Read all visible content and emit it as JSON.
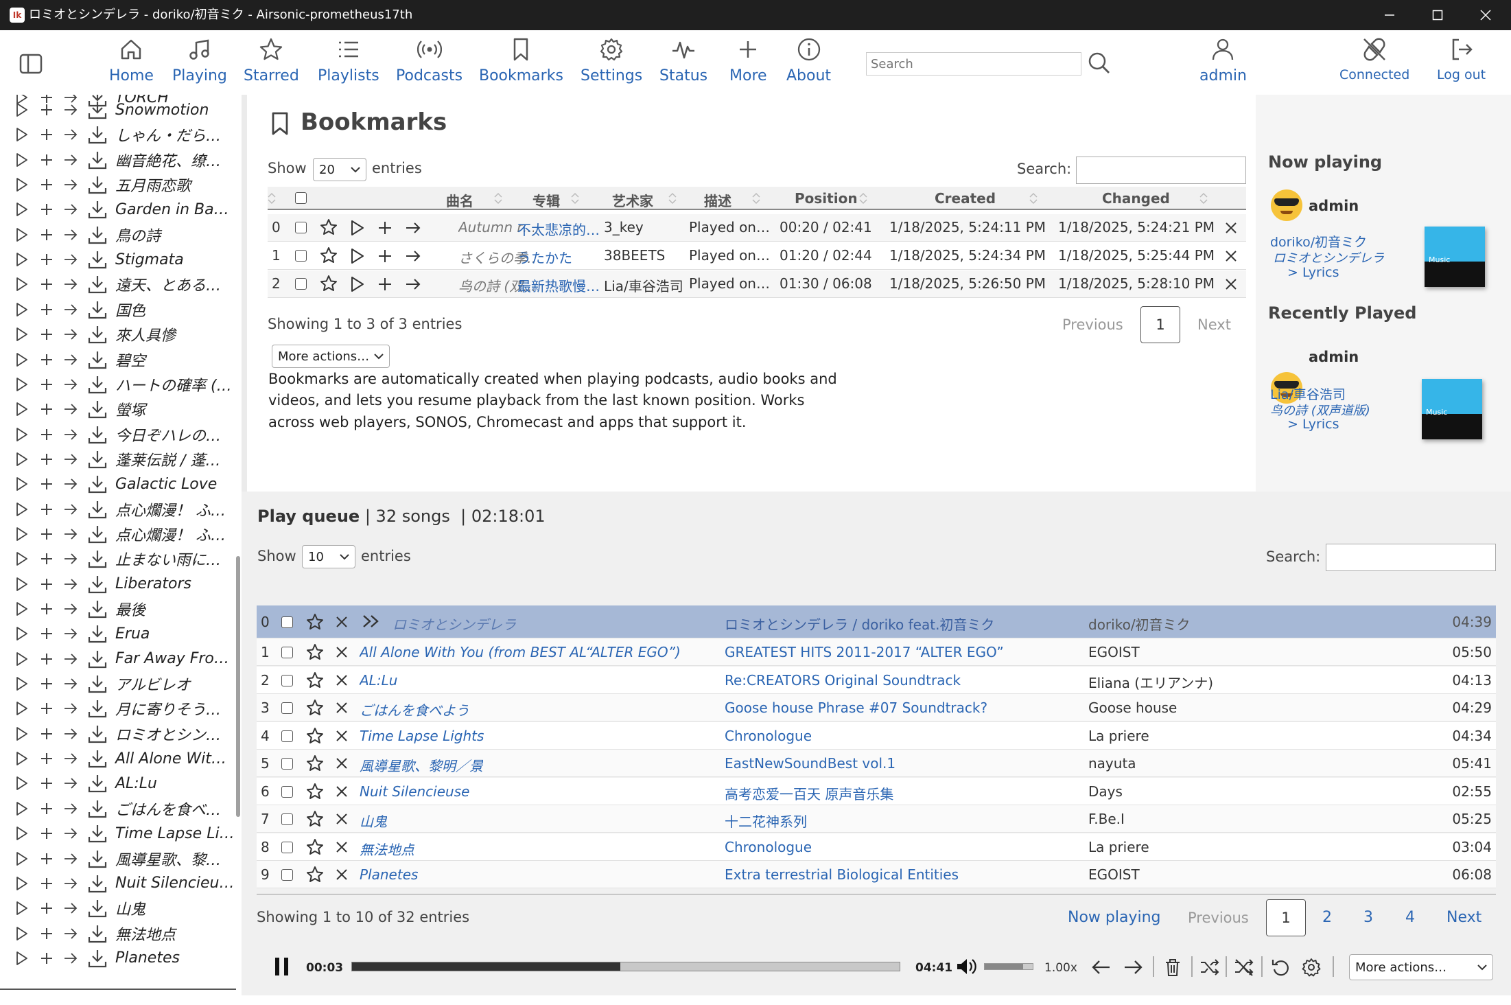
{
  "window": {
    "title": "ロミオとシンデレラ - doriko/初音ミク - Airsonic-prometheus17th",
    "app_icon": "Ik"
  },
  "nav": {
    "items": [
      {
        "label": "Home",
        "icon": "home-icon"
      },
      {
        "label": "Playing",
        "icon": "music-note-icon"
      },
      {
        "label": "Starred",
        "icon": "star-icon"
      },
      {
        "label": "Playlists",
        "icon": "list-icon"
      },
      {
        "label": "Podcasts",
        "icon": "podcast-icon"
      },
      {
        "label": "Bookmarks",
        "icon": "bookmark-icon"
      },
      {
        "label": "Settings",
        "icon": "gear-icon"
      },
      {
        "label": "Status",
        "icon": "pulse-icon"
      },
      {
        "label": "More",
        "icon": "plus-icon"
      },
      {
        "label": "About",
        "icon": "info-icon"
      }
    ],
    "search_placeholder": "Search",
    "user": "admin",
    "connected": "Connected",
    "logout": "Log out"
  },
  "sidebar": {
    "items": [
      "TORCH",
      "Snowmotion",
      "しゃん・だら…",
      "幽音絶花、缭…",
      "五月雨恋歌",
      "Garden in Ba…",
      "鳥の詩",
      "Stigmata",
      "遠天、とある…",
      "国色",
      "來人具慘",
      "碧空",
      "ハートの確率 (…",
      "螢塚",
      "今日ぞハレの…",
      "蓬莱伝説 / 蓬…",
      "Galactic Love",
      "点心爛漫！ ふ…",
      "点心爛漫！ ふ…",
      "止まない雨に…",
      "Liberators",
      "最後",
      "Erua",
      "Far Away Fro…",
      "アルビレオ",
      "月に寄りそう…",
      "ロミオとシン…",
      "All Alone Wit…",
      "AL:Lu",
      "ごはんを食べ…",
      "Time Lapse Li…",
      "風導星歌、黎…",
      "Nuit Silencieu…",
      "山鬼",
      "無法地点",
      "Planetes"
    ]
  },
  "bookmarks": {
    "title": "Bookmarks",
    "show_label": "Show",
    "page_size": "20",
    "entries_label": "entries",
    "search_label": "Search:",
    "columns": [
      "曲名",
      "专辑",
      "艺术家",
      "描述",
      "Position",
      "Created",
      "Changed"
    ],
    "rows": [
      {
        "idx": "0",
        "title": "Autumn r…",
        "album": "不太悲凉的…",
        "artist": "3_key",
        "desc": "Played on…",
        "position": "00:20 / 02:41",
        "created": "1/18/2025, 5:24:11 PM",
        "changed": "1/18/2025, 5:24:21 PM"
      },
      {
        "idx": "1",
        "title": "さくらの季…",
        "album": "うたかた",
        "artist": "38BEETS",
        "desc": "Played on…",
        "position": "01:20 / 02:44",
        "created": "1/18/2025, 5:24:34 PM",
        "changed": "1/18/2025, 5:25:44 PM"
      },
      {
        "idx": "2",
        "title": "鸟の詩 (双…",
        "album": "最新热歌慢…",
        "artist": "Lia/車谷浩司",
        "desc": "Played on…",
        "position": "01:30 / 06:08",
        "created": "1/18/2025, 5:26:50 PM",
        "changed": "1/18/2025, 5:28:10 PM"
      }
    ],
    "showing": "Showing 1 to 3 of 3 entries",
    "prev": "Previous",
    "page": "1",
    "next": "Next",
    "more_actions": "More actions…",
    "description": [
      "Bookmarks are automatically created when playing podcasts, audio books and",
      "videos, and lets you resume playback from the last known position. Works",
      "across web players, SONOS, Chromecast and apps that support it."
    ]
  },
  "now_playing": {
    "title": "Now playing",
    "user": "admin",
    "artist": "doriko/初音ミク",
    "song": "ロミオとシンデレラ",
    "lyrics": "Lyrics",
    "cover_text": "Music"
  },
  "recently_played": {
    "title": "Recently Played",
    "user": "admin",
    "artist": "Lia/車谷浩司",
    "song": "鸟の詩 (双声道版)",
    "lyrics": "Lyrics",
    "cover_text": "Music"
  },
  "queue": {
    "title": "Play queue",
    "count": "32 songs",
    "duration": "02:18:01",
    "show_label": "Show",
    "page_size": "10",
    "entries_label": "entries",
    "search_label": "Search:",
    "rows": [
      {
        "idx": "0",
        "title": "ロミオとシンデレラ",
        "album": "ロミオとシンデレラ / doriko feat.初音ミク",
        "artist": "doriko/初音ミク",
        "time": "04:39",
        "current": true
      },
      {
        "idx": "1",
        "title": "All Alone With You (from BEST AL“ALTER EGO”)",
        "album": "GREATEST HITS 2011-2017 “ALTER EGO”",
        "artist": "EGOIST",
        "time": "05:50"
      },
      {
        "idx": "2",
        "title": "AL:Lu",
        "album": "Re:CREATORS Original Soundtrack",
        "artist": "Eliana (エリアンナ)",
        "time": "04:13"
      },
      {
        "idx": "3",
        "title": "ごはんを食べよう",
        "album": "Goose house Phrase #07 Soundtrack?",
        "artist": "Goose house",
        "time": "04:29"
      },
      {
        "idx": "4",
        "title": "Time Lapse Lights",
        "album": "Chronologue",
        "artist": "La priere",
        "time": "04:34"
      },
      {
        "idx": "5",
        "title": "風導星歌、黎明／景",
        "album": "EastNewSoundBest vol.1",
        "artist": "nayuta",
        "time": "05:41"
      },
      {
        "idx": "6",
        "title": "Nuit Silencieuse",
        "album": "高考恋爱一百天 原声音乐集",
        "artist": "Days",
        "time": "02:55"
      },
      {
        "idx": "7",
        "title": "山鬼",
        "album": "十二花神系列",
        "artist": "F.Be.I",
        "time": "05:25"
      },
      {
        "idx": "8",
        "title": "無法地点",
        "album": "Chronologue",
        "artist": "La priere",
        "time": "03:04"
      },
      {
        "idx": "9",
        "title": "Planetes",
        "album": "Extra terrestrial Biological Entities",
        "artist": "EGOIST",
        "time": "06:08"
      }
    ],
    "showing": "Showing 1 to 10 of 32 entries",
    "now_playing_link": "Now playing",
    "prev": "Previous",
    "pages": [
      "1",
      "2",
      "3",
      "4"
    ],
    "next": "Next"
  },
  "player": {
    "elapsed": "00:03",
    "total": "04:41",
    "progress": 0.49,
    "volume": 0.8,
    "speed": "1.00x",
    "more_actions": "More actions…"
  },
  "colors": {
    "accent": "#2a65b3",
    "current_row": "#a6b8d6",
    "titlebar": "#1f1f1f"
  }
}
